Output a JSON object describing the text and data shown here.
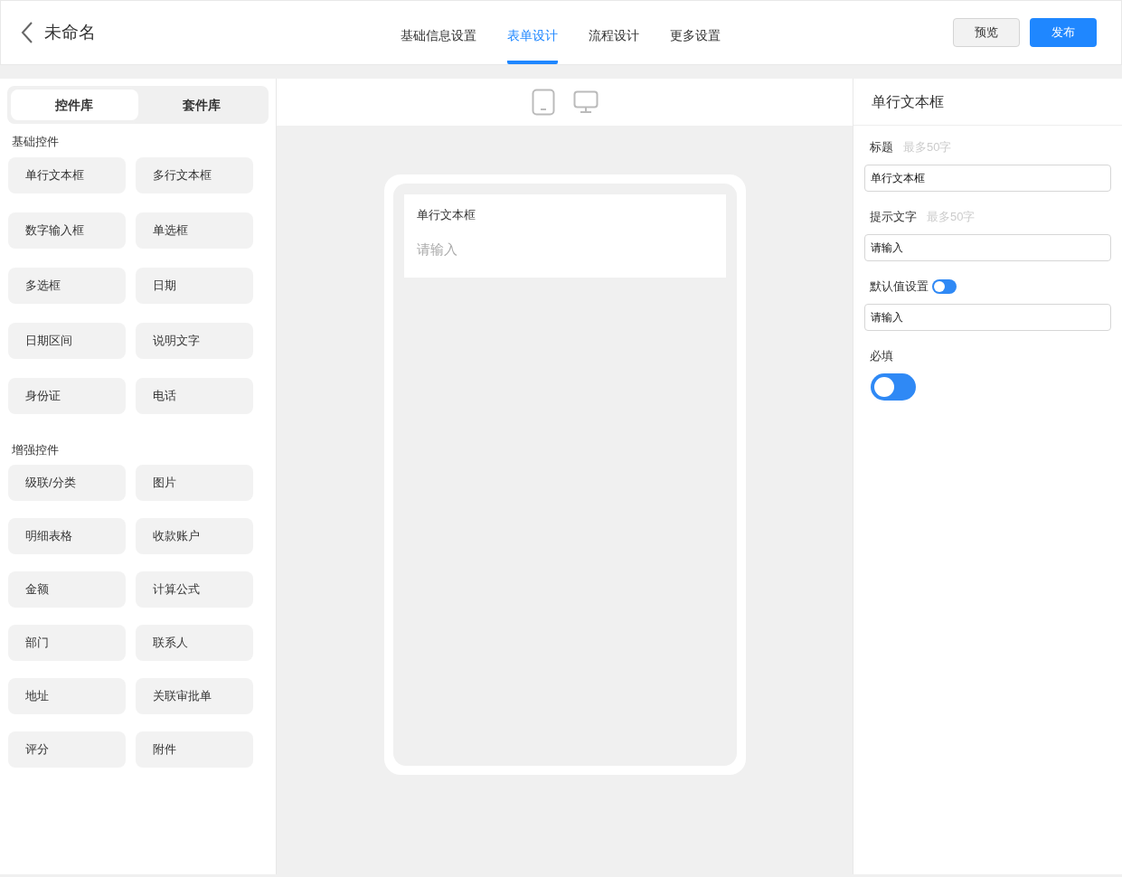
{
  "header": {
    "title": "未命名",
    "tabs": [
      {
        "label": "基础信息设置",
        "selected": false
      },
      {
        "label": "表单设计",
        "selected": true
      },
      {
        "label": "流程设计",
        "selected": false
      },
      {
        "label": "更多设置",
        "selected": false
      }
    ],
    "buttons": [
      {
        "label": "预览",
        "kind": "secondary"
      },
      {
        "label": "发布",
        "kind": "primary"
      }
    ]
  },
  "library": {
    "tabs": [
      {
        "label": "控件库",
        "selected": true
      },
      {
        "label": "套件库",
        "selected": false
      }
    ],
    "groups": [
      {
        "title": "基础控件",
        "items": [
          "单行文本框",
          "多行文本框",
          "数字输入框",
          "单选框",
          "多选框",
          "日期",
          "日期区间",
          "说明文字",
          "身份证",
          "电话"
        ]
      },
      {
        "title": "增强控件",
        "items": [
          "级联/分类",
          "图片",
          "明细表格",
          "收款账户",
          "金额",
          "计算公式",
          "部门",
          "联系人",
          "地址",
          "关联审批单",
          "评分",
          "附件"
        ]
      }
    ]
  },
  "canvas": {
    "devices": [
      {
        "kind": "mobile",
        "selected": false
      },
      {
        "kind": "desktop",
        "selected": false
      }
    ],
    "field": {
      "label": "单行文本框",
      "placeholder": "请输入"
    }
  },
  "properties": {
    "title": "单行文本框",
    "rows": [
      {
        "kind": "input",
        "label": "标题",
        "hint": "最多50字",
        "value": "单行文本框"
      },
      {
        "kind": "input",
        "label": "提示文字",
        "hint": "最多50字",
        "value": "请输入"
      },
      {
        "kind": "toggle-input",
        "label": "默认值设置",
        "on": false,
        "value": "请输入"
      },
      {
        "kind": "toggle",
        "label": "必填",
        "on": false
      }
    ]
  }
}
